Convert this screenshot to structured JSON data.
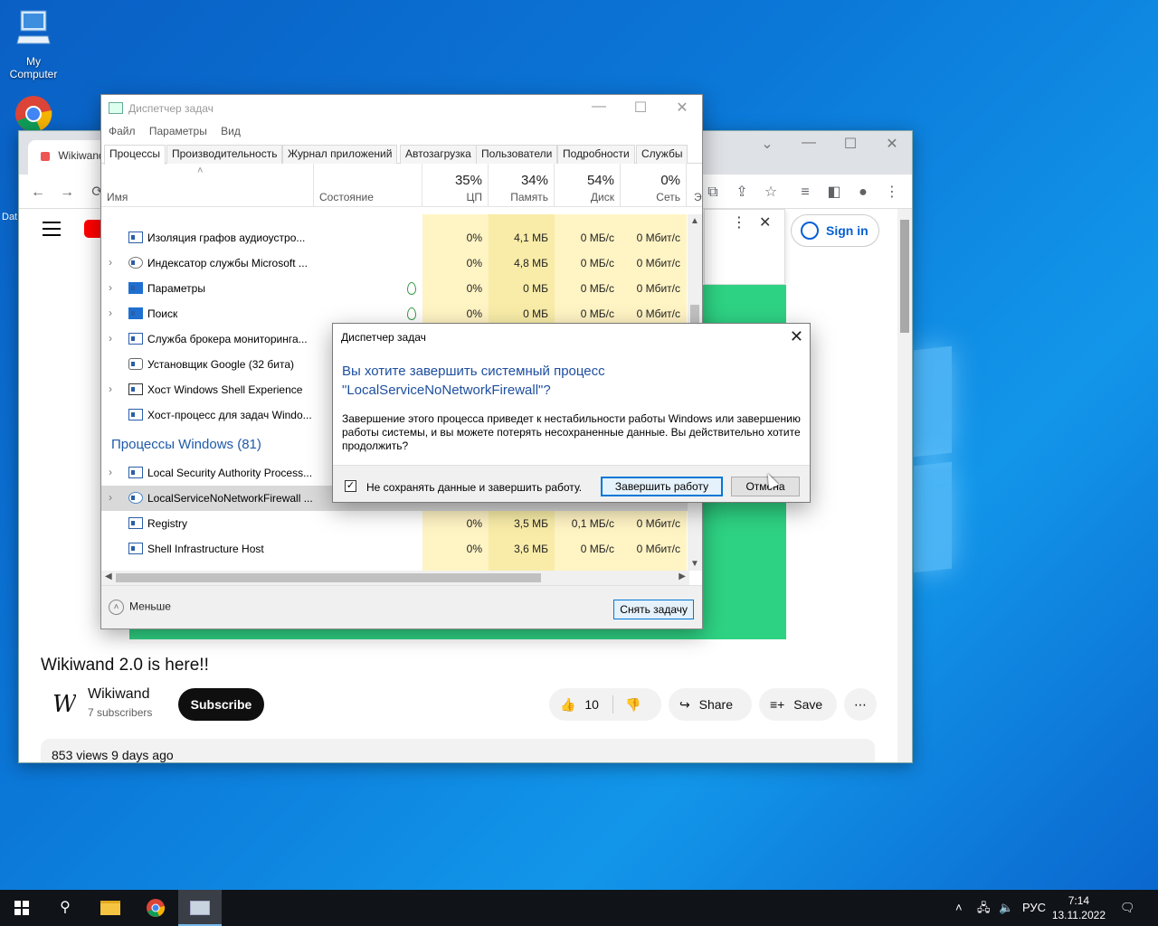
{
  "desktop": {
    "icons": [
      {
        "label_line1": "My",
        "label_line2": "Computer"
      }
    ]
  },
  "browser": {
    "tab_title": "Wikiwand",
    "signin_label": "Sign in",
    "video_title": "Wikiwand 2.0 is here!!",
    "channel_name": "Wikiwand",
    "channel_subs": "7 subscribers",
    "subscribe_label": "Subscribe",
    "likes": "10",
    "share_label": "Share",
    "save_label": "Save",
    "views": "853 views  9 days ago",
    "accent_color": "#2ed283"
  },
  "taskmanager": {
    "title": "Диспетчер задач",
    "menu": [
      "Файл",
      "Параметры",
      "Вид"
    ],
    "tabs": [
      "Процессы",
      "Производительность",
      "Журнал приложений",
      "Автозагрузка",
      "Пользователи",
      "Подробности",
      "Службы"
    ],
    "columns": {
      "name": "Имя",
      "status": "Состояние",
      "cpu_pct": "35%",
      "cpu": "ЦП",
      "mem_pct": "34%",
      "mem": "Память",
      "disk_pct": "54%",
      "disk": "Диск",
      "net_pct": "0%",
      "net": "Сеть",
      "extra": "Э"
    },
    "rows": [
      {
        "name": "Изоляция графов аудиоустро...",
        "cpu": "0%",
        "mem": "4,1 МБ",
        "disk": "0 МБ/с",
        "net": "0 Мбит/с"
      },
      {
        "name": "Индексатор службы Microsoft ...",
        "cpu": "0%",
        "mem": "4,8 МБ",
        "disk": "0 МБ/с",
        "net": "0 Мбит/с"
      },
      {
        "name": "Параметры",
        "cpu": "0%",
        "mem": "0 МБ",
        "disk": "0 МБ/с",
        "net": "0 Мбит/с"
      },
      {
        "name": "Поиск",
        "cpu": "0%",
        "mem": "0 МБ",
        "disk": "0 МБ/с",
        "net": "0 Мбит/с"
      },
      {
        "name": "Служба брокера мониторинга..."
      },
      {
        "name": "Установщик Google (32 бита)"
      },
      {
        "name": "Хост Windows Shell Experience"
      },
      {
        "name": "Хост-процесс для задач Windo..."
      }
    ],
    "group_header": "Процессы Windows (81)",
    "rows2": [
      {
        "name": "Local Security Authority Process..."
      },
      {
        "name": "LocalServiceNoNetworkFirewall ..."
      },
      {
        "name": "Registry",
        "cpu": "0%",
        "mem": "3,5 МБ",
        "disk": "0,1 МБ/с",
        "net": "0 Мбит/с"
      },
      {
        "name": "Shell Infrastructure Host",
        "cpu": "0%",
        "mem": "3,6 МБ",
        "disk": "0 МБ/с",
        "net": "0 Мбит/с"
      }
    ],
    "less_label": "Меньше",
    "end_task_label": "Снять задачу"
  },
  "dialog": {
    "title": "Диспетчер задач",
    "question_line1": "Вы хотите завершить системный процесс",
    "question_line2": "\"LocalServiceNoNetworkFirewall\"?",
    "message": "Завершение этого процесса приведет к нестабильности работы Windows или завершению работы системы, и вы можете потерять несохраненные данные. Вы действительно хотите продолжить?",
    "checkbox_label": "Не сохранять данные и завершить работу.",
    "checkbox_checked": true,
    "confirm_label": "Завершить работу",
    "cancel_label": "Отмена"
  },
  "taskbar": {
    "lang": "РУС",
    "time": "7:14",
    "date": "13.11.2022"
  }
}
